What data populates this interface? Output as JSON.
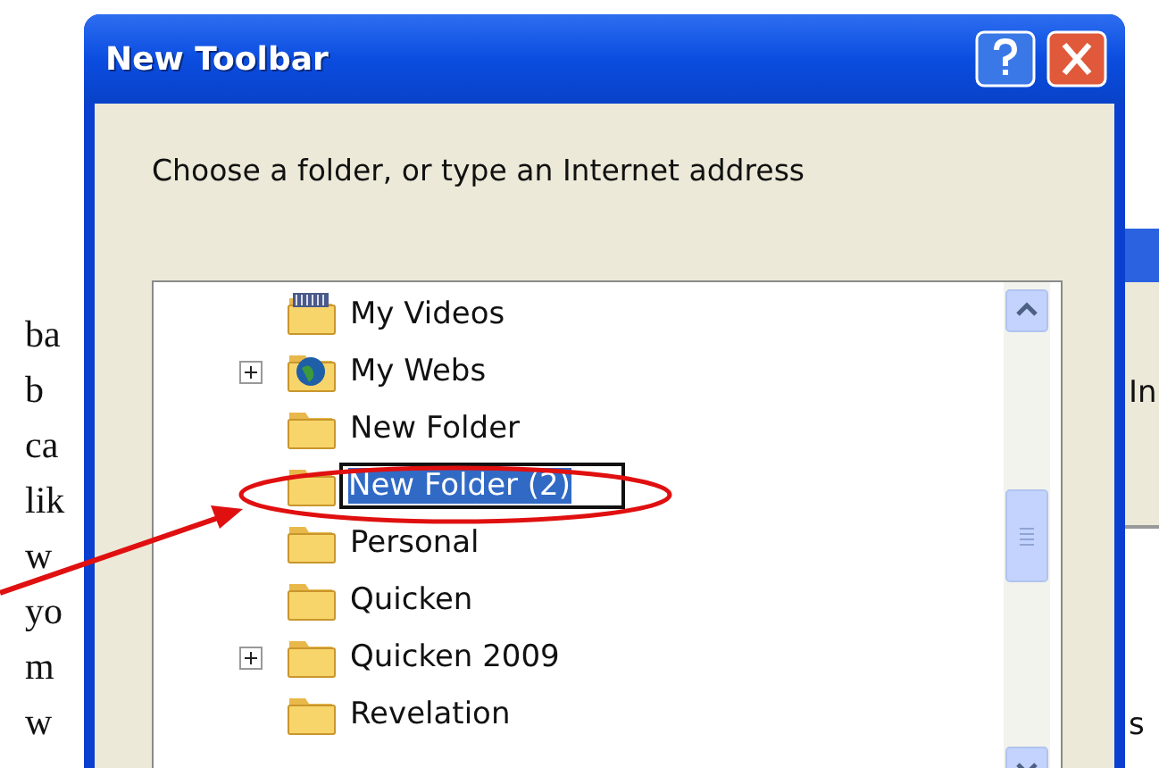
{
  "background_text": [
    "ba",
    "b",
    "ca",
    "lik",
    "w",
    "yo",
    "m",
    "w"
  ],
  "dialog": {
    "title": "New Toolbar",
    "prompt": "Choose a folder, or type an Internet address",
    "tree": [
      {
        "kind": "videos",
        "label": "My Videos",
        "has_children": false,
        "editing": false
      },
      {
        "kind": "web",
        "label": "My Webs",
        "has_children": true,
        "editing": false
      },
      {
        "kind": "folder",
        "label": "New Folder",
        "has_children": false,
        "editing": false
      },
      {
        "kind": "folder",
        "label": "New Folder (2)",
        "has_children": false,
        "editing": true
      },
      {
        "kind": "folder",
        "label": "Personal",
        "has_children": false,
        "editing": false
      },
      {
        "kind": "folder",
        "label": "Quicken",
        "has_children": false,
        "editing": false
      },
      {
        "kind": "folder",
        "label": "Quicken 2009",
        "has_children": true,
        "editing": false
      },
      {
        "kind": "folder",
        "label": "Revelation",
        "has_children": false,
        "editing": false
      }
    ]
  },
  "side_window": {
    "text_1": "In",
    "text_2": "s"
  }
}
